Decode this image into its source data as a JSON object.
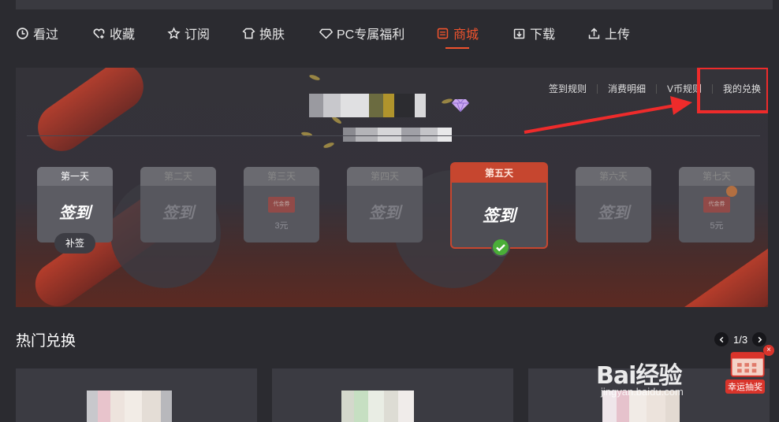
{
  "nav": {
    "items": [
      {
        "label": "看过",
        "icon": "clock-icon"
      },
      {
        "label": "收藏",
        "icon": "heart-plus-icon"
      },
      {
        "label": "订阅",
        "icon": "star-icon"
      },
      {
        "label": "换肤",
        "icon": "shirt-icon"
      },
      {
        "label": "PC专属福利",
        "icon": "diamond-icon"
      },
      {
        "label": "商城",
        "icon": "store-icon",
        "active": true
      },
      {
        "label": "下载",
        "icon": "download-icon"
      },
      {
        "label": "上传",
        "icon": "upload-icon"
      }
    ]
  },
  "banner": {
    "links": [
      "签到规则",
      "消费明细",
      "V币规则",
      "我的兑换"
    ]
  },
  "days": [
    {
      "title": "第一天",
      "label": "签到",
      "button": "补签"
    },
    {
      "title": "第二天",
      "label": "签到"
    },
    {
      "title": "第三天",
      "coupon": "代金券",
      "price": "3元"
    },
    {
      "title": "第四天",
      "label": "签到"
    },
    {
      "title": "第五天",
      "label": "签到"
    },
    {
      "title": "第六天",
      "label": "签到"
    },
    {
      "title": "第七天",
      "coupon": "代金券",
      "price": "5元"
    }
  ],
  "hot": {
    "title": "热门兑换",
    "pager": "1/3"
  },
  "watermark": {
    "logo": "Bai经验",
    "sub": "jingyan.baidu.com"
  },
  "lottery": {
    "label": "幸运抽奖"
  },
  "colors": {
    "accent": "#f0532d",
    "highlight": "#ee2b2b",
    "check": "#4aae38"
  }
}
